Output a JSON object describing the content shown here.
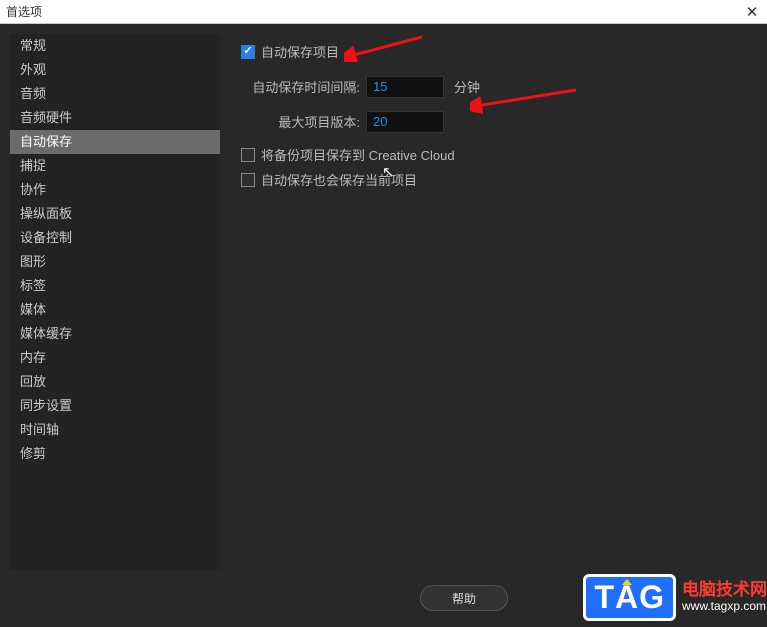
{
  "title": "首选项",
  "sidebar": {
    "items": [
      {
        "label": "常规"
      },
      {
        "label": "外观"
      },
      {
        "label": "音频"
      },
      {
        "label": "音频硬件"
      },
      {
        "label": "自动保存",
        "active": true
      },
      {
        "label": "捕捉"
      },
      {
        "label": "协作"
      },
      {
        "label": "操纵面板"
      },
      {
        "label": "设备控制"
      },
      {
        "label": "图形"
      },
      {
        "label": "标签"
      },
      {
        "label": "媒体"
      },
      {
        "label": "媒体缓存"
      },
      {
        "label": "内存"
      },
      {
        "label": "回放"
      },
      {
        "label": "同步设置"
      },
      {
        "label": "时间轴"
      },
      {
        "label": "修剪"
      }
    ]
  },
  "content": {
    "autoSaveLabel": "自动保存项目",
    "autoSaveChecked": true,
    "intervalLabel": "自动保存时间间隔:",
    "intervalValue": "15",
    "intervalUnit": "分钟",
    "maxVersionsLabel": "最大项目版本:",
    "maxVersionsValue": "20",
    "backupCloudLabel": "将备份项目保存到 Creative Cloud",
    "backupCloudChecked": false,
    "saveCurrentLabel": "自动保存也会保存当前项目",
    "saveCurrentChecked": false
  },
  "footer": {
    "helpLabel": "帮助"
  },
  "watermark": {
    "tag": "TAG",
    "cn": "电脑技术网",
    "url": "www.tagxp.com"
  }
}
